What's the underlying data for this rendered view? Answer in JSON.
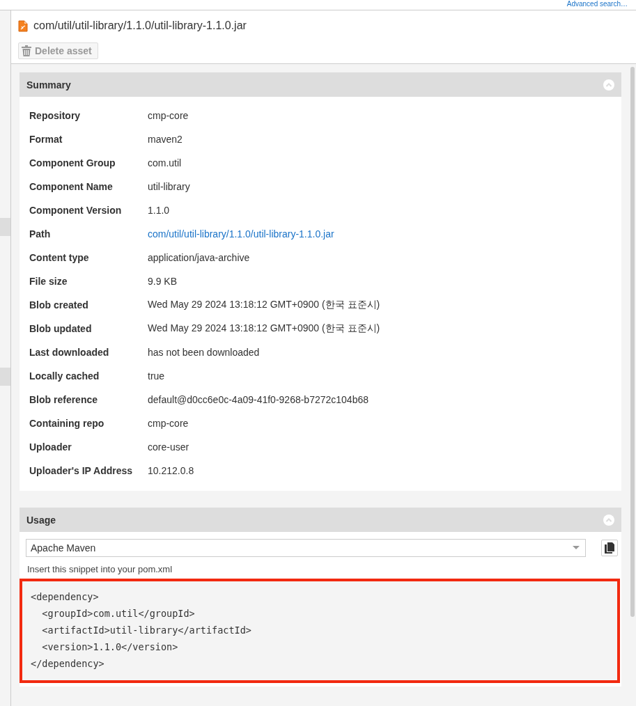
{
  "top_link": "Advanced search…",
  "sidebar": {
    "highlights": [
      {
        "selected": true
      },
      {
        "selected": true
      }
    ]
  },
  "asset": {
    "title": "com/util/util-library/1.1.0/util-library-1.1.0.jar",
    "delete_button": {
      "label": "Delete asset",
      "disabled": true
    }
  },
  "summary": {
    "title": "Summary",
    "expanded": true,
    "rows": [
      {
        "label": "Repository",
        "value": "cmp-core",
        "kind": "text"
      },
      {
        "label": "Format",
        "value": "maven2",
        "kind": "text"
      },
      {
        "label": "Component Group",
        "value": "com.util",
        "kind": "text"
      },
      {
        "label": "Component Name",
        "value": "util-library",
        "kind": "text"
      },
      {
        "label": "Component Version",
        "value": "1.1.0",
        "kind": "text"
      },
      {
        "label": "Path",
        "value": "com/util/util-library/1.1.0/util-library-1.1.0.jar",
        "kind": "link"
      },
      {
        "label": "Content type",
        "value": "application/java-archive",
        "kind": "text"
      },
      {
        "label": "File size",
        "value": "9.9 KB",
        "kind": "text"
      },
      {
        "label": "Blob created",
        "value": "Wed May 29 2024 13:18:12 GMT+0900 (한국 표준시)",
        "kind": "text"
      },
      {
        "label": "Blob updated",
        "value": "Wed May 29 2024 13:18:12 GMT+0900 (한국 표준시)",
        "kind": "text"
      },
      {
        "label": "Last downloaded",
        "value": "has not been downloaded",
        "kind": "text"
      },
      {
        "label": "Locally cached",
        "value": "true",
        "kind": "text"
      },
      {
        "label": "Blob reference",
        "value": "default@d0cc6e0c-4a09-41f0-9268-b7272c104b68",
        "kind": "text"
      },
      {
        "label": "Containing repo",
        "value": "cmp-core",
        "kind": "text"
      },
      {
        "label": "Uploader",
        "value": "core-user",
        "kind": "text"
      },
      {
        "label": "Uploader's IP Address",
        "value": "10.212.0.8",
        "kind": "text"
      }
    ]
  },
  "usage": {
    "title": "Usage",
    "expanded": true,
    "format_select": {
      "value": "Apache Maven"
    },
    "hint": "Insert this snippet into your pom.xml",
    "snippet": {
      "highlighted": true,
      "lines": [
        "<dependency>",
        "  <groupId>com.util</groupId>",
        "  <artifactId>util-library</artifactId>",
        "  <version>1.1.0</version>",
        "</dependency>"
      ]
    }
  }
}
